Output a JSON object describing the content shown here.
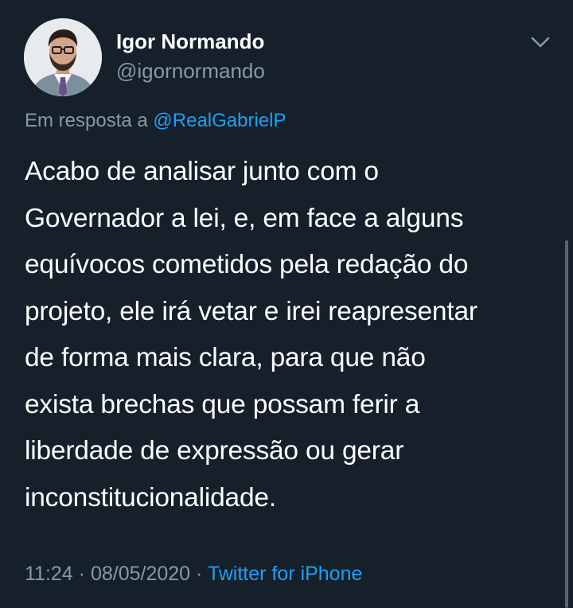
{
  "author": {
    "display_name": "Igor Normando",
    "handle": "@igornormando"
  },
  "reply": {
    "prefix": "Em resposta a",
    "mention": "@RealGabrielP"
  },
  "tweet": {
    "text": "Acabo de analisar junto com o\nGovernador a lei, e, em face a alguns\nequívocos cometidos pela redação do\nprojeto, ele irá vetar e irei reapresentar\nde forma mais clara, para que não\nexista brechas que possam ferir a\nliberdade de expressão ou gerar\ninconstitucionalidade."
  },
  "meta": {
    "time": "11:24",
    "separator": "·",
    "date": "08/05/2020",
    "source": "Twitter for iPhone"
  },
  "icons": {
    "menu": "chevron-down-icon"
  },
  "colors": {
    "background": "#15202b",
    "text_primary": "#ffffff",
    "text_secondary": "#8899a6",
    "accent": "#1da1f2"
  }
}
